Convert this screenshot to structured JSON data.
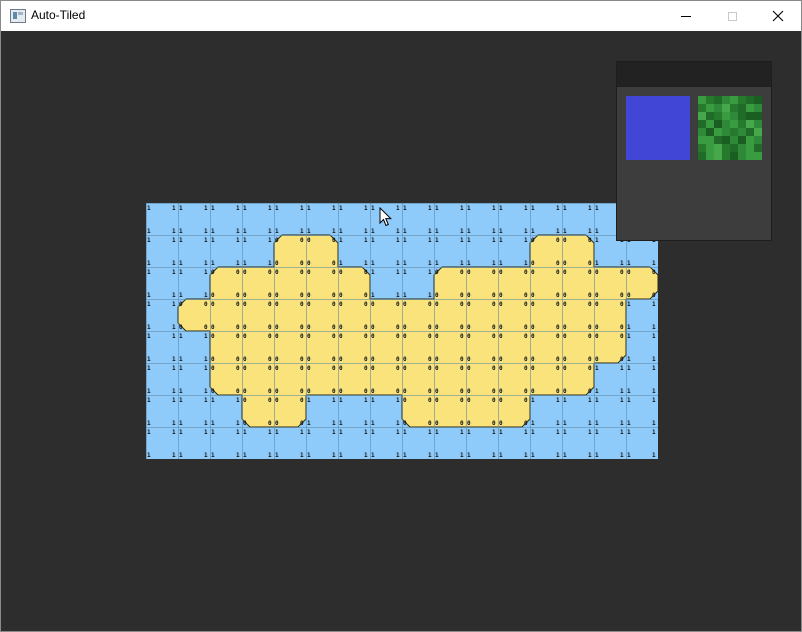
{
  "window": {
    "title": "Auto-Tiled"
  },
  "palette": {
    "tiles": [
      {
        "name": "water",
        "color": "#4146d6"
      },
      {
        "name": "grass",
        "color": "#2e8a38"
      }
    ]
  },
  "tilemap": {
    "colors": {
      "water": "#8ecbfb",
      "sand": "#fbe37c",
      "grid": "#5f8ca8",
      "outline": "#2a2a10",
      "label": "#111111"
    },
    "grid": [
      "1111111111111111",
      "1111001111110011",
      "1100000110000000",
      "1000000000000001",
      "1100000000000001",
      "1100000000000011",
      "1110011100001111",
      "1111111111111111"
    ]
  }
}
